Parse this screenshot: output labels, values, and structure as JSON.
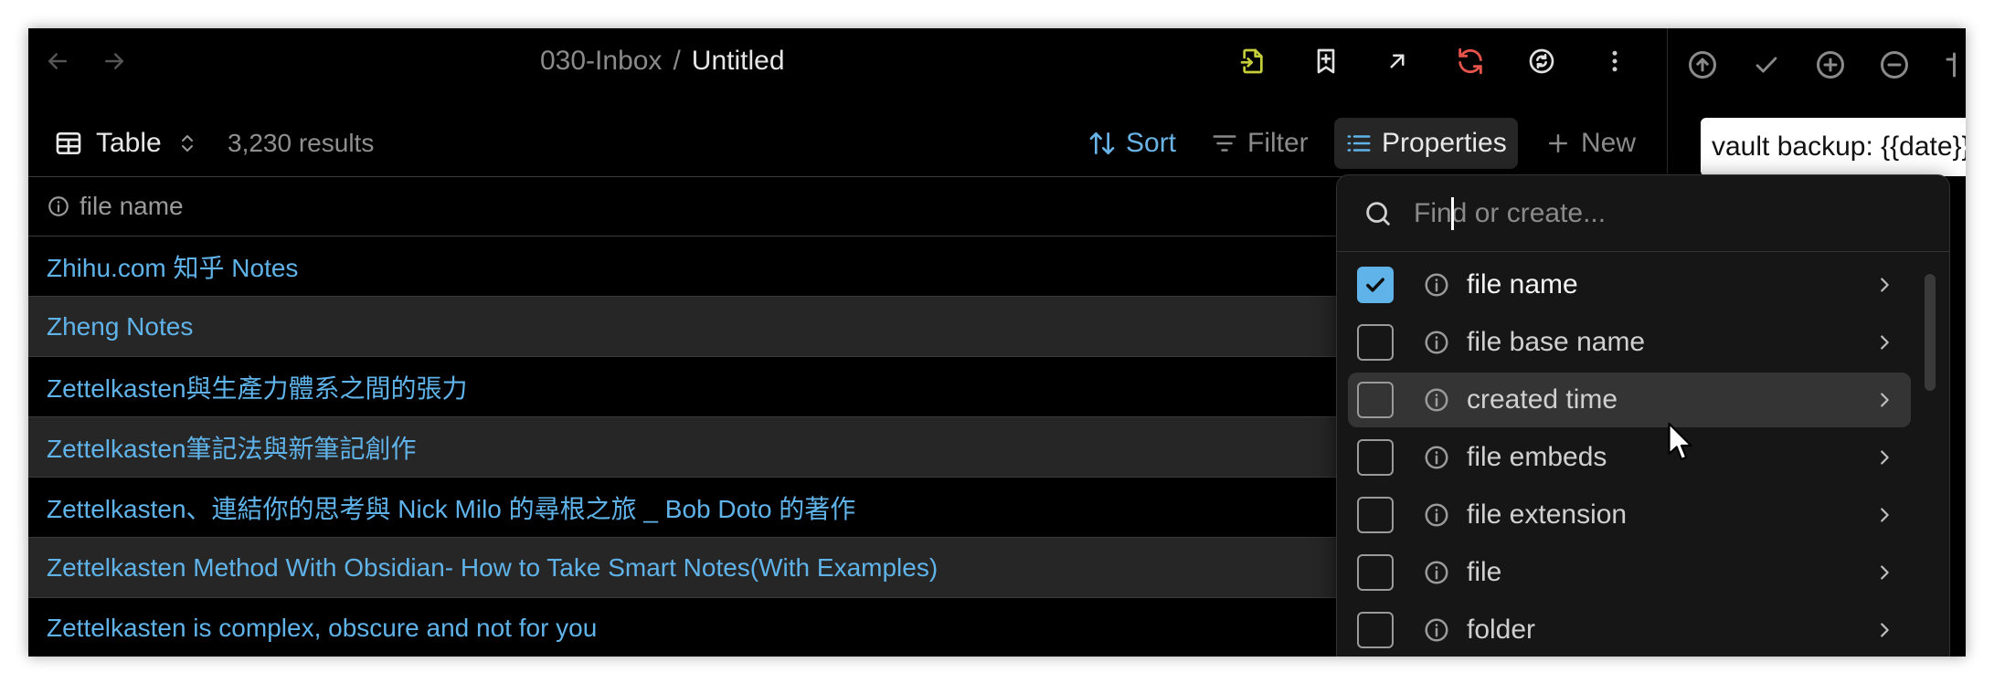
{
  "breadcrumb": {
    "folder": "030-Inbox",
    "separator": "/",
    "current": "Untitled"
  },
  "toolbar": {
    "view_label": "Table",
    "result_count": "3,230 results",
    "sort_label": "Sort",
    "filter_label": "Filter",
    "properties_label": "Properties",
    "new_label": "New"
  },
  "table": {
    "header": "file name",
    "rows": [
      "Zhihu.com 知乎 Notes",
      "Zheng Notes",
      "Zettelkasten與生產力體系之間的張力",
      "Zettelkasten筆記法與新筆記創作",
      "Zettelkasten、連結你的思考與 Nick Milo 的尋根之旅 _ Bob Doto 的著作",
      "Zettelkasten Method With Obsidian- How to Take Smart Notes(With Examples)",
      "Zettelkasten is complex, obscure and not for you"
    ]
  },
  "dropdown": {
    "search_placeholder": "Find or create...",
    "items": [
      {
        "label": "file name",
        "checked": true
      },
      {
        "label": "file base name",
        "checked": false
      },
      {
        "label": "created time",
        "checked": false
      },
      {
        "label": "file embeds",
        "checked": false
      },
      {
        "label": "file extension",
        "checked": false
      },
      {
        "label": "file",
        "checked": false
      },
      {
        "label": "folder",
        "checked": false
      }
    ]
  },
  "right_panel": {
    "commit_message": "vault backup: {{date}}"
  },
  "colors": {
    "accent": "#5fb3e9",
    "sort_active": "#69b3e7",
    "note_icon": "#c6cf3a",
    "sync_icon": "#e5534b",
    "window_bg": "#000000",
    "row_alt_bg": "#262626"
  }
}
